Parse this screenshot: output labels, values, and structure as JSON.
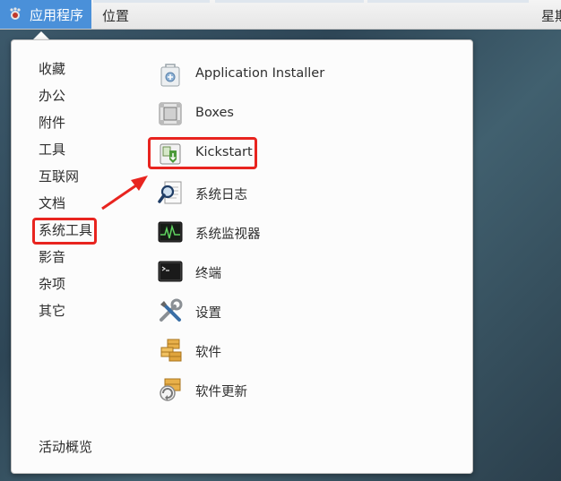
{
  "topbar": {
    "apps_label": "应用程序",
    "places_label": "位置",
    "clock_text": "星期"
  },
  "categories": [
    "收藏",
    "办公",
    "附件",
    "工具",
    "互联网",
    "文档",
    "系统工具",
    "影音",
    "杂项",
    "其它"
  ],
  "activities_label": "活动概览",
  "apps": [
    {
      "name": "Application Installer",
      "icon": "package-installer-icon"
    },
    {
      "name": "Boxes",
      "icon": "boxes-icon"
    },
    {
      "name": "Kickstart",
      "icon": "kickstart-icon"
    },
    {
      "name": "系统日志",
      "icon": "log-viewer-icon"
    },
    {
      "name": "系统监视器",
      "icon": "system-monitor-icon"
    },
    {
      "name": "终端",
      "icon": "terminal-icon"
    },
    {
      "name": "设置",
      "icon": "settings-tools-icon"
    },
    {
      "name": "软件",
      "icon": "software-icon"
    },
    {
      "name": "软件更新",
      "icon": "software-update-icon"
    }
  ],
  "colors": {
    "accent": "#4a90d9",
    "highlight": "#e8241f"
  }
}
